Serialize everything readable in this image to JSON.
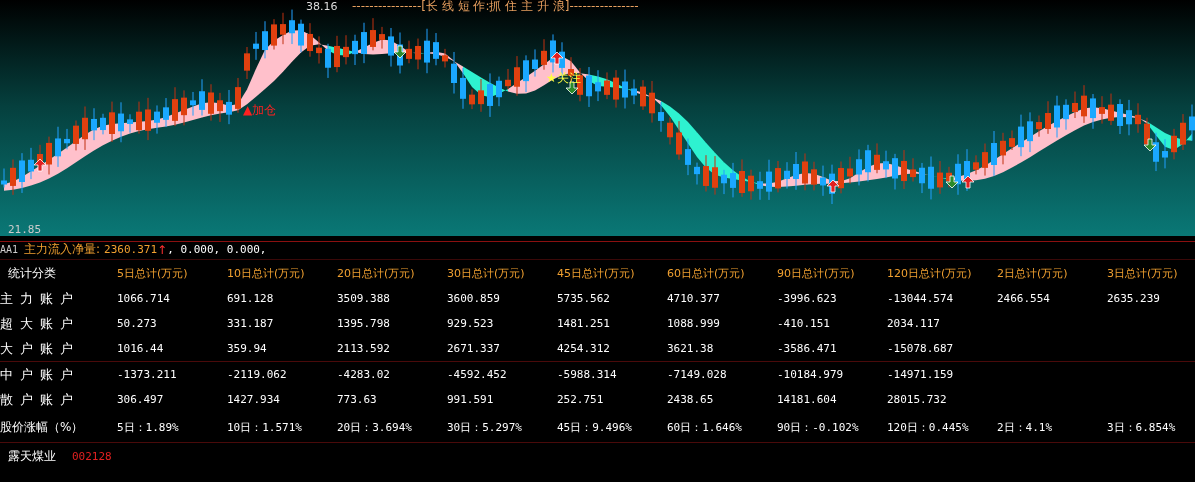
{
  "chart": {
    "title": "----------------[长 线 短 作:抓 住 主 升 浪]----------------",
    "high_label": "38.16",
    "low_label": "21.85",
    "signals": [
      {
        "kind": "add",
        "text": "▲加仓"
      },
      {
        "kind": "watch",
        "text": "★关注"
      }
    ]
  },
  "indicator": {
    "name": "AA1",
    "label": "主力流入净量:",
    "value": "2360.371",
    "arrow": "↑",
    "rest": ", 0.000, 0.000,"
  },
  "table": {
    "columns": [
      "统计分类",
      "5日总计(万元)",
      "10日总计(万元)",
      "20日总计(万元)",
      "30日总计(万元)",
      "45日总计(万元)",
      "60日总计(万元)",
      "90日总计(万元)",
      "120日总计(万元)",
      "2日总计(万元)",
      "3日总计(万元)"
    ],
    "rows": [
      {
        "cells": [
          "主力账户",
          "1066.714",
          "691.128",
          "3509.388",
          "3600.859",
          "5735.562",
          "4710.377",
          "-3996.623",
          "-13044.574",
          "2466.554",
          "2635.239"
        ]
      },
      {
        "cells": [
          "超大账户",
          "50.273",
          "331.187",
          "1395.798",
          "929.523",
          "1481.251",
          "1088.999",
          "-410.151",
          "2034.117"
        ]
      },
      {
        "cells": [
          "大户账户",
          "1016.44",
          "359.94",
          "2113.592",
          "2671.337",
          "4254.312",
          "3621.38",
          "-3586.471",
          "-15078.687"
        ]
      },
      {
        "cells": [
          "中户账户",
          "-1373.211",
          "-2119.062",
          "-4283.02",
          "-4592.452",
          "-5988.314",
          "-7149.028",
          "-10184.979",
          "-14971.159"
        ]
      },
      {
        "cells": [
          "散户账户",
          "306.497",
          "1427.934",
          "773.63",
          "991.591",
          "252.751",
          "2438.65",
          "14181.604",
          "28015.732"
        ]
      },
      {
        "cells": [
          "股价涨幅（%）",
          "5日：1.89%",
          "10日：1.571%",
          "20日：3.694%",
          "30日：5.297%",
          "45日：9.496%",
          "60日：1.646%",
          "90日：-0.102%",
          "120日：0.445%",
          "2日：4.1%",
          "3日：6.854%"
        ]
      }
    ]
  },
  "stock": {
    "name": "露天煤业",
    "code": "002128"
  }
}
